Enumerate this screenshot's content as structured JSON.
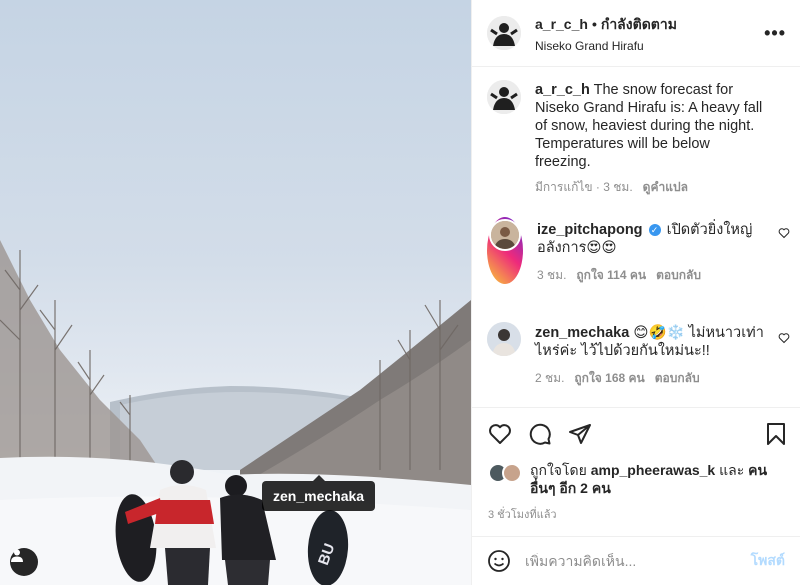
{
  "post": {
    "tag_label": "zen_mechaka",
    "user_tag_icon": "person-icon"
  },
  "header": {
    "username": "a_r_c_h",
    "separator": "•",
    "follow_status": "กำลังติดตาม",
    "location": "Niseko Grand Hirafu",
    "more_icon": "•••"
  },
  "caption": {
    "username": "a_r_c_h",
    "text": "The snow forecast for Niseko Grand Hirafu is: A heavy fall of snow, heaviest during the night. Temperatures will be below freezing.",
    "edited": "มีการแก้ไข · 3 ชม.",
    "translate": "ดูคำแปล"
  },
  "comments": [
    {
      "username": "ize_pitchapong",
      "verified": "✓",
      "text": "เปิดตัวยิ่งใหญ่อลังการ😍😍",
      "time": "3 ชม.",
      "likes": "ถูกใจ 114 คน",
      "reply": "ตอบกลับ"
    },
    {
      "username": "zen_mechaka",
      "text": "😊🤣❄️ ไม่หนาวเท่าไหร่ค่ะ ไว้ไปด้วยกันใหม่นะ!!",
      "time": "2 ชม.",
      "likes": "ถูกใจ 168 คน",
      "reply": "ตอบกลับ"
    }
  ],
  "likes": {
    "prefix": "ถูกใจโดย",
    "user": "amp_pheerawas_k",
    "conj": "และ",
    "others": "คนอื่นๆ อีก 2 คน"
  },
  "time_ago": "3 ชั่วโมงที่แล้ว",
  "add_comment": {
    "placeholder": "เพิ่มความคิดเห็น...",
    "post_label": "โพสต์"
  },
  "colors": {
    "verified": "#3897f0",
    "post_button": "#b3dbff",
    "muted_text": "#8e8e8e"
  }
}
